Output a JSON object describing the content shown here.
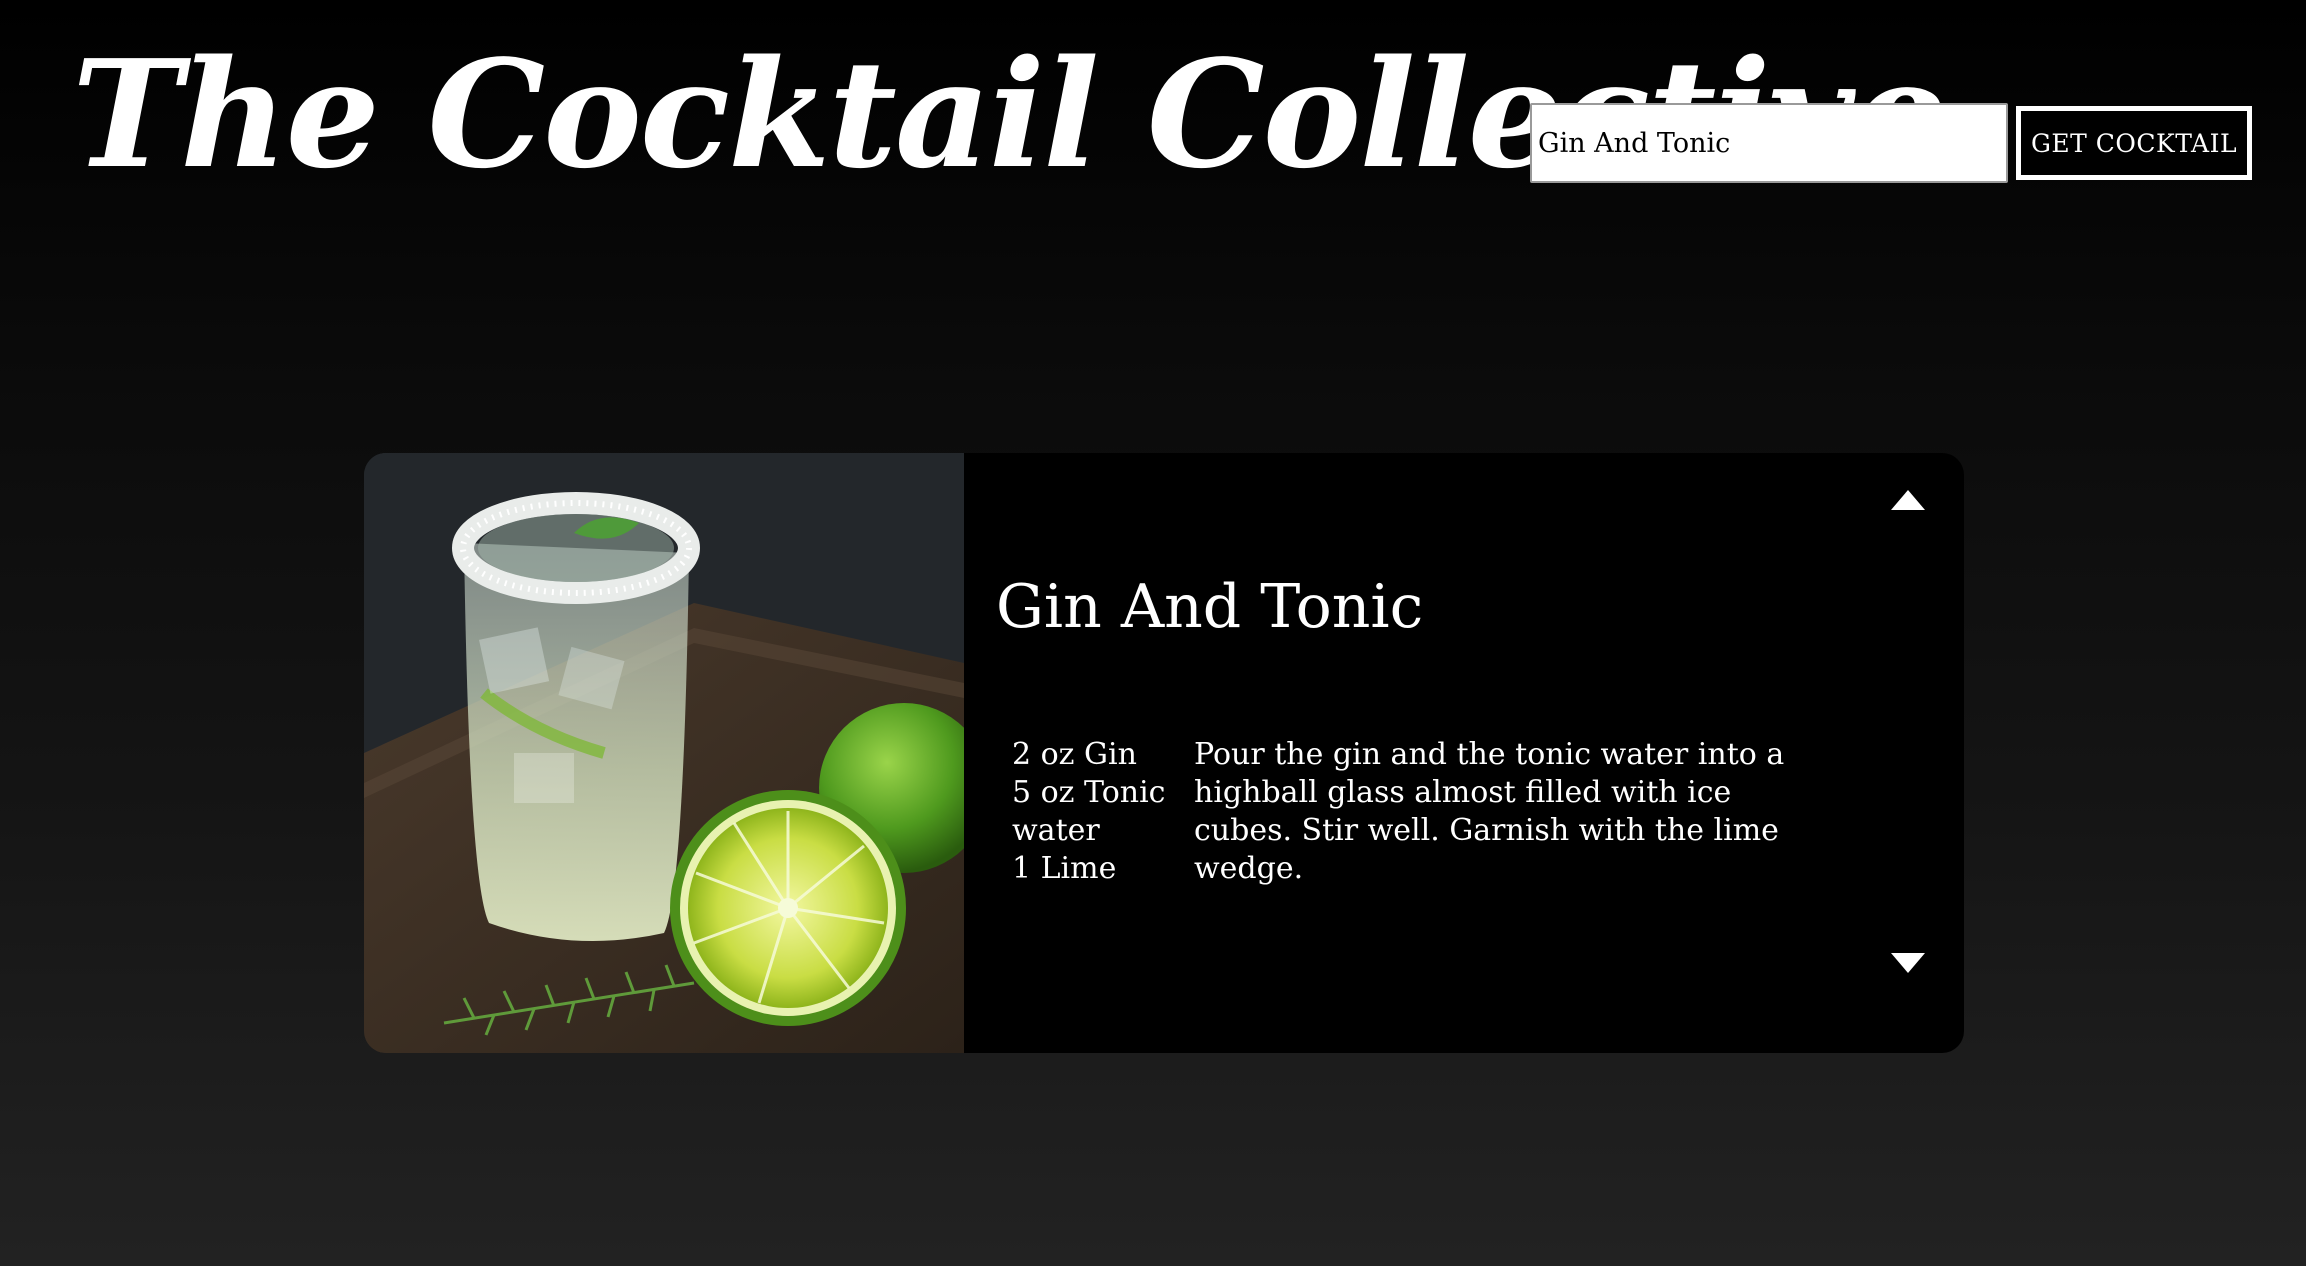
{
  "header": {
    "title": "The Cocktail Collective"
  },
  "search": {
    "value": "Gin And Tonic",
    "button_label": "GET COCKTAIL"
  },
  "cocktail": {
    "name": "Gin And Tonic",
    "ingredients": [
      "2 oz Gin",
      "5 oz Tonic water",
      "1 Lime"
    ],
    "instructions": "Pour the gin and the tonic water into a highball glass almost filled with ice cubes. Stir well. Garnish with the lime wedge."
  },
  "controls": {
    "up_icon": "triangle-up-icon",
    "down_icon": "triangle-down-icon"
  }
}
